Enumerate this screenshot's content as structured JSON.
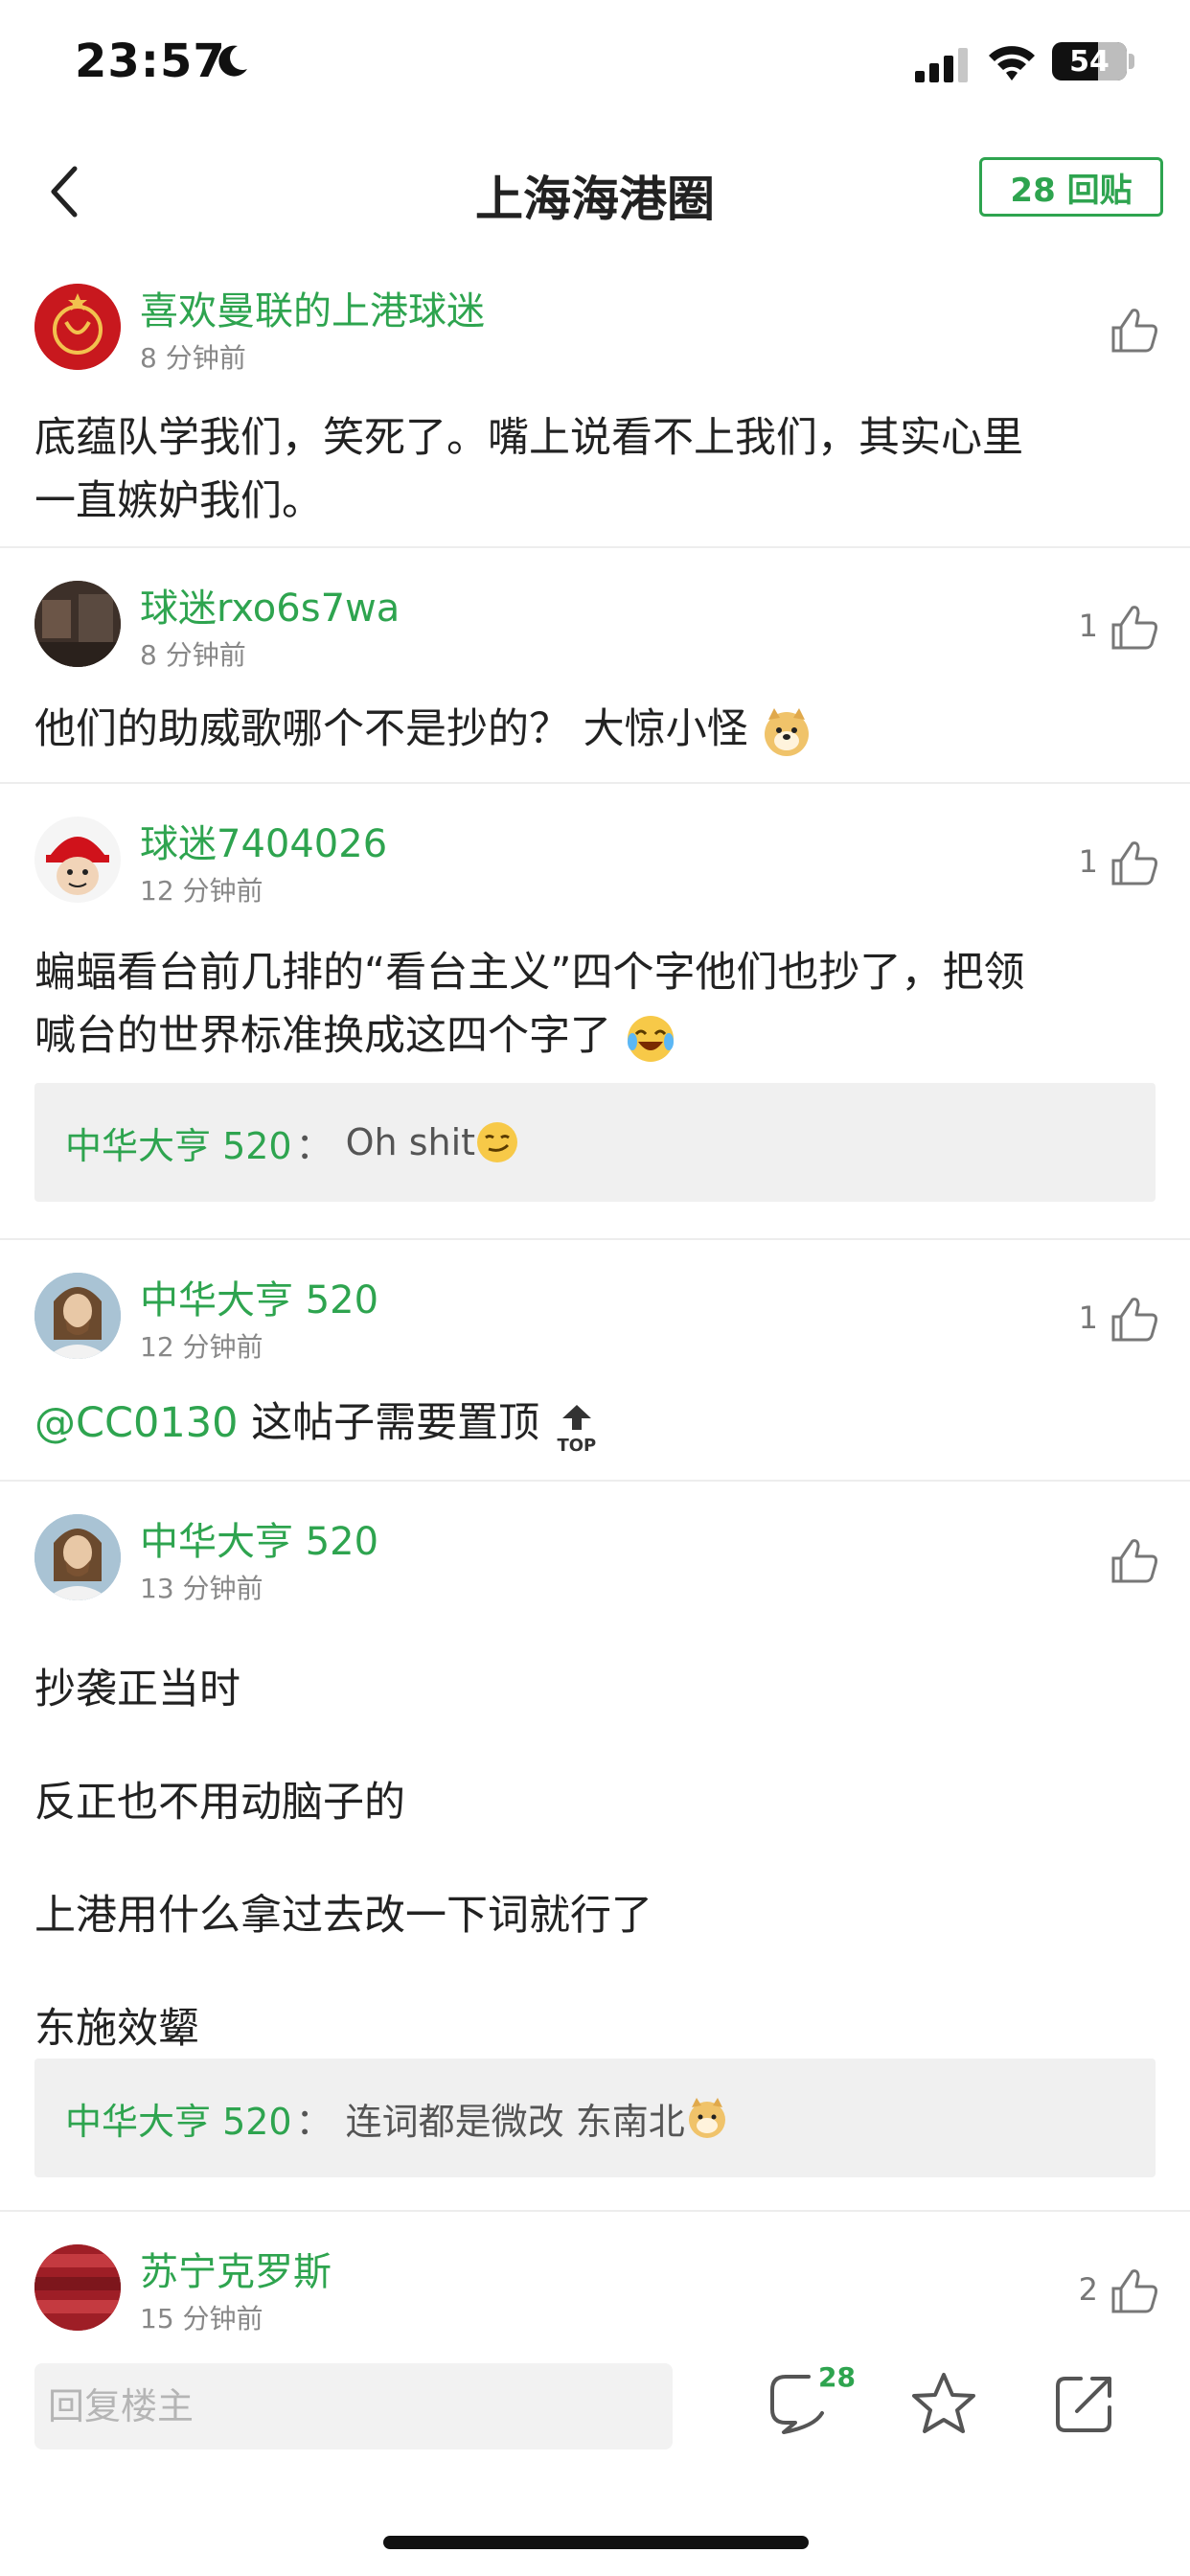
{
  "status_bar": {
    "time": "23:57",
    "battery": "54"
  },
  "nav": {
    "title": "上海海港圈",
    "reply_button": "28 回贴"
  },
  "posts": [
    {
      "username": "喜欢曼联的上港球迷",
      "time": "8 分钟前",
      "likes": "",
      "lines": [
        "底蕴队学我们，笑死了。嘴上说看不上我们，其实心里",
        "一直嫉妒我们。"
      ]
    },
    {
      "username": "球迷rxo6s7wa",
      "time": "8 分钟前",
      "likes": "1",
      "lines": [
        "他们的助威歌哪个不是抄的？ 大惊小怪"
      ]
    },
    {
      "username": "球迷7404026",
      "time": "12 分钟前",
      "likes": "1",
      "lines": [
        "蝙蝠看台前几排的“看台主义”四个字他们也抄了，把领",
        "喊台的世界标准换成这四个字了"
      ],
      "quote": {
        "name": "中华大亨 520",
        "sep": "：",
        "text": "Oh shit"
      }
    },
    {
      "username": "中华大亨 520",
      "time": "12 分钟前",
      "likes": "1",
      "mention": "@CC0130",
      "lines": [
        "这帖子需要置顶"
      ],
      "top_label": "TOP"
    },
    {
      "username": "中华大亨 520",
      "time": "13 分钟前",
      "likes": "",
      "lines": [
        "抄袭正当时",
        "反正也不用动脑子的",
        "上港用什么拿过去改一下词就行了",
        "东施效颦"
      ],
      "quote": {
        "name": "中华大亨 520",
        "sep": "：",
        "text": "连词都是微改 东南北"
      }
    },
    {
      "username": "苏宁克罗斯",
      "time": "15 分钟前",
      "likes": "2",
      "lines": []
    }
  ],
  "bottom_bar": {
    "reply_placeholder": "回复楼主",
    "comment_count": "28"
  },
  "colors": {
    "accent": "#2ea44f",
    "text": "#222222",
    "muted": "#888888",
    "quote_bg": "#f0f0f0"
  }
}
